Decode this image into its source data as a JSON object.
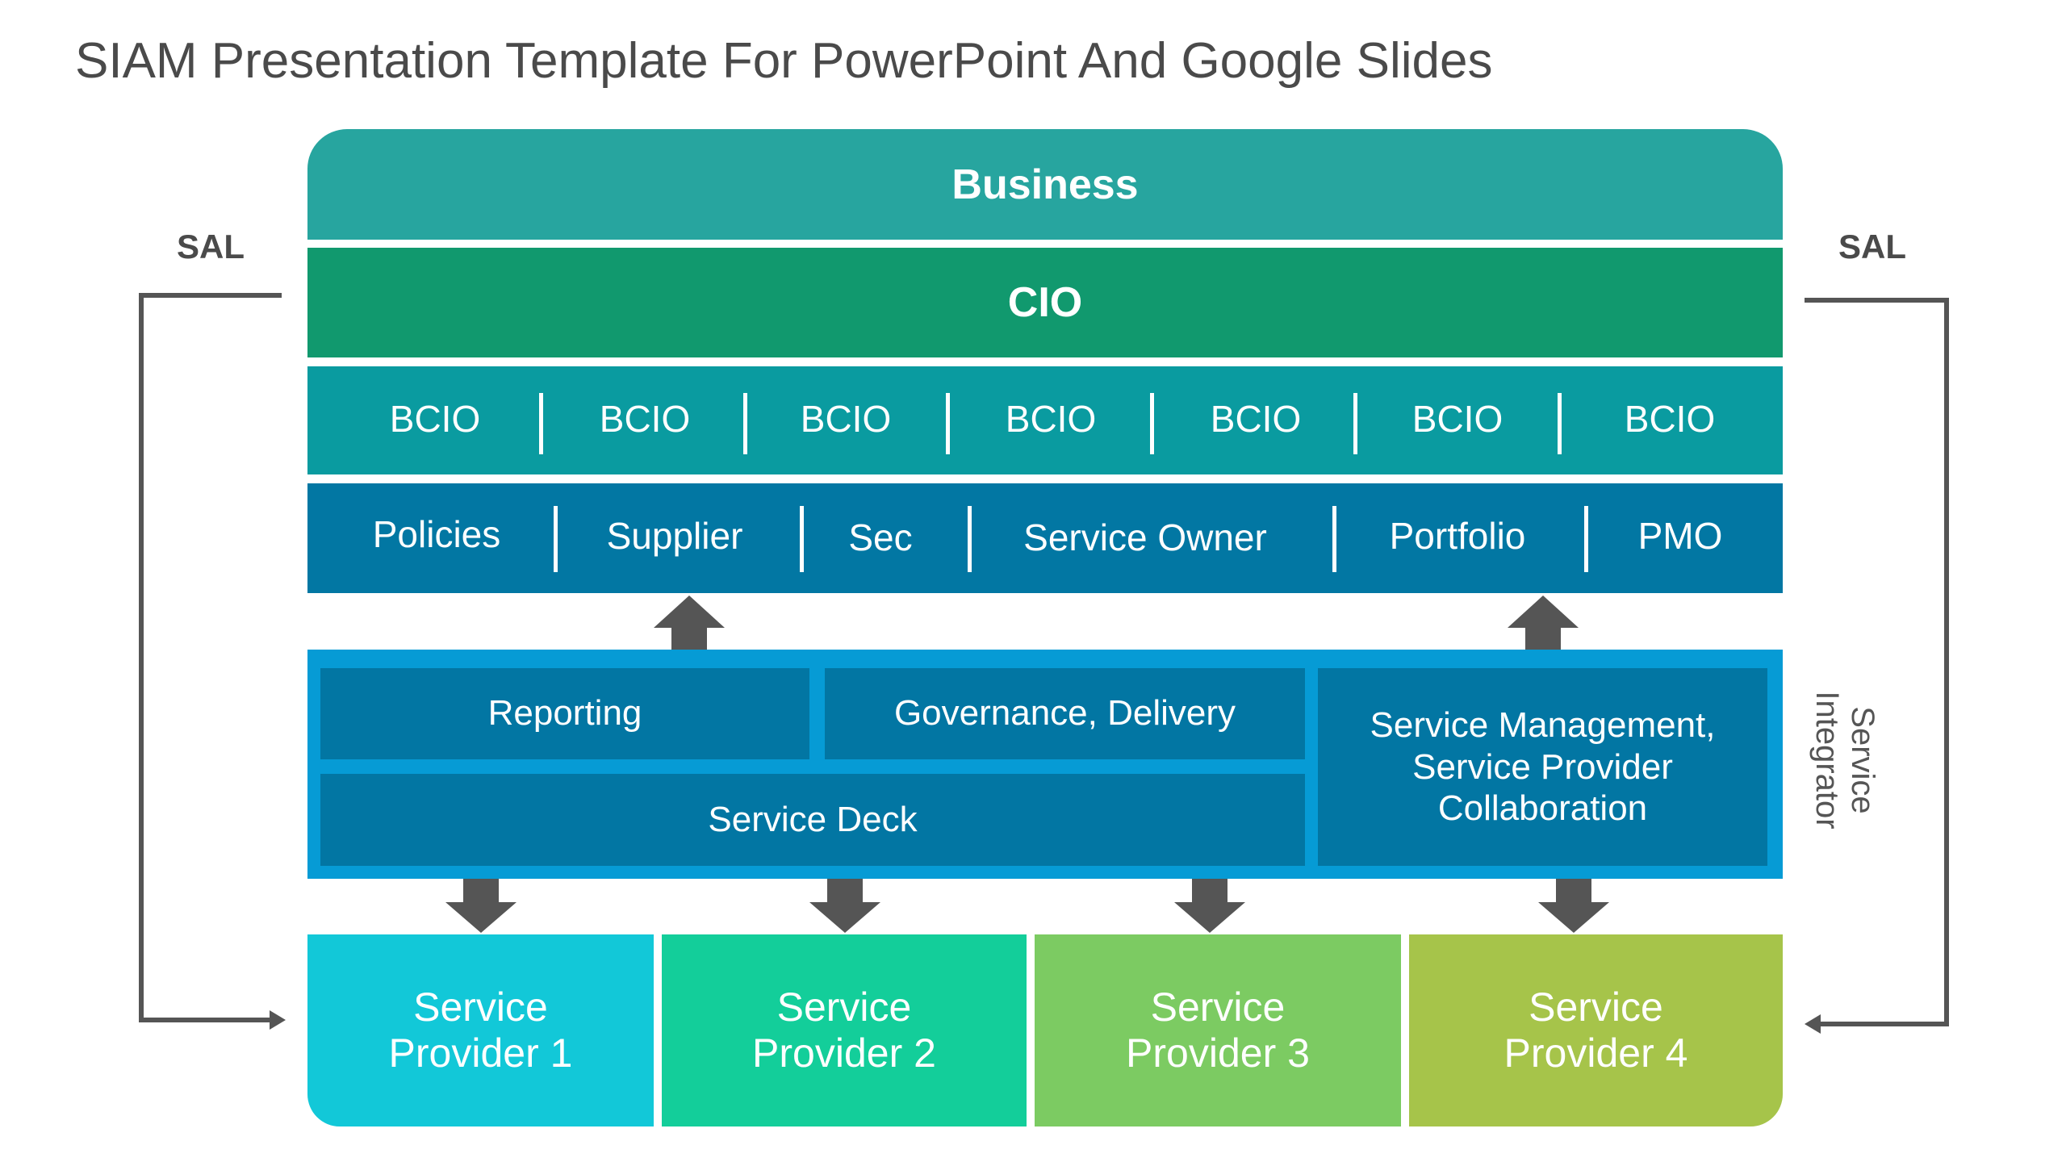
{
  "title": "SIAM Presentation Template For PowerPoint And Google Slides",
  "layers": {
    "business": "Business",
    "cio": "CIO",
    "bcio": [
      "BCIO",
      "BCIO",
      "BCIO",
      "BCIO",
      "BCIO",
      "BCIO",
      "BCIO"
    ],
    "functions": [
      "Policies",
      "Supplier",
      "Sec",
      "Service Owner",
      "Portfolio",
      "PMO"
    ]
  },
  "service_integrator": {
    "label_line1": "Service",
    "label_line2": "Integrator",
    "reporting": "Reporting",
    "governance": "Governance, Delivery",
    "service_deck": "Service Deck",
    "service_management": [
      "Service Management,",
      "Service Provider",
      "Collaboration"
    ]
  },
  "providers": [
    {
      "line1": "Service",
      "line2": "Provider 1",
      "color": "#12c8d8"
    },
    {
      "line1": "Service",
      "line2": "Provider 2",
      "color": "#13ce9a"
    },
    {
      "line1": "Service",
      "line2": "Provider 3",
      "color": "#7ccb62"
    },
    {
      "line1": "Service",
      "line2": "Provider 4",
      "color": "#a6c44a"
    }
  ],
  "sal_left": "SAL",
  "sal_right": "SAL",
  "colors": {
    "business": "#27a59f",
    "cio": "#11996e",
    "bcio": "#0a9ba0",
    "functions": "#0277a3",
    "integrator_frame": "#069bd5",
    "integrator_cell": "#0276a3",
    "arrow": "#555555"
  }
}
